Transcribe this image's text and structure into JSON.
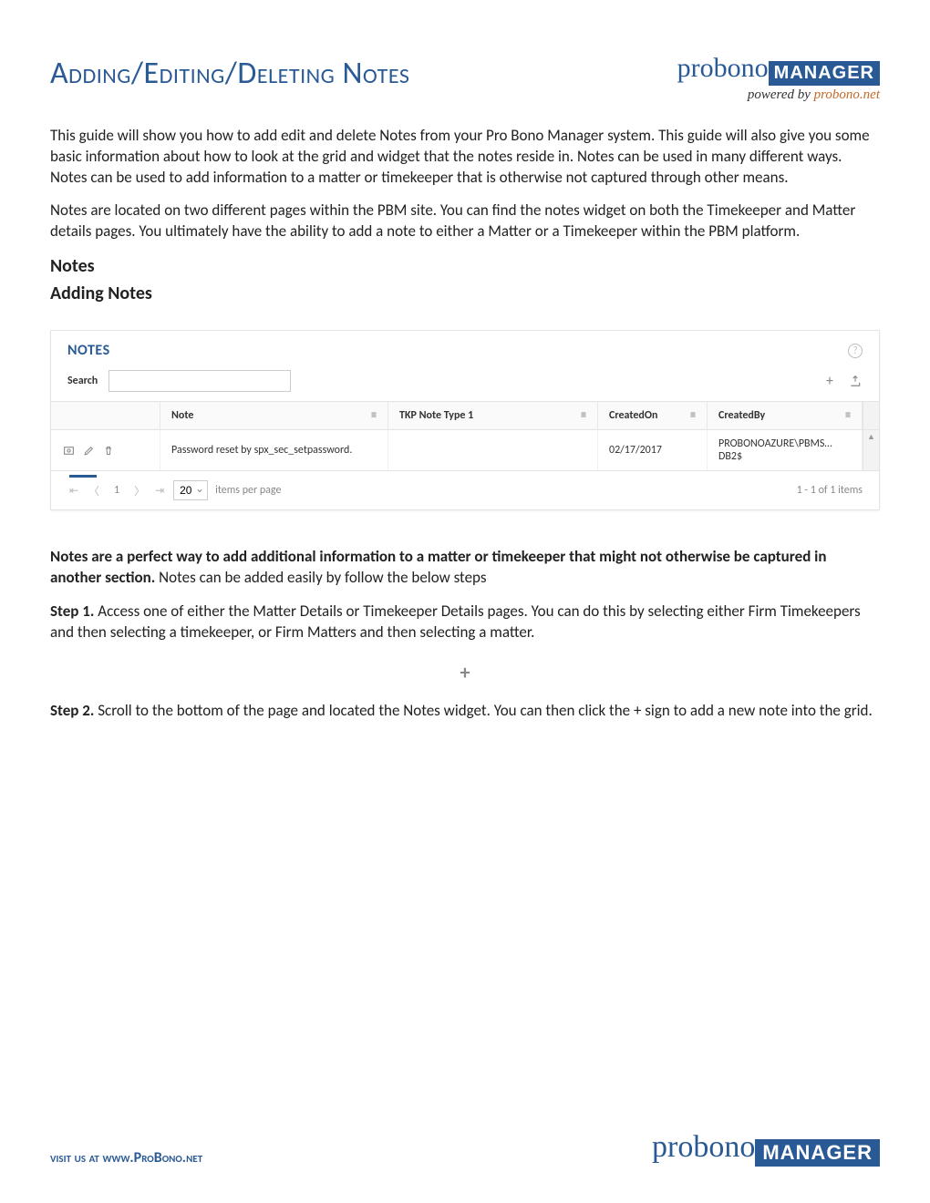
{
  "header": {
    "title": "Adding/Editing/Deleting Notes",
    "logo_word": "probono",
    "logo_badge": "MANAGER",
    "logo_sub_prefix": "powered by ",
    "logo_sub_link": "probono.net"
  },
  "intro": {
    "p1": "This guide will show you how to add edit and delete Notes from your Pro Bono Manager system. This guide will also give you some basic information about how to look at the grid and widget that the notes reside in. Notes can be used in many different ways. Notes can be used to add information to a matter or timekeeper that is otherwise not captured through other means.",
    "p2": "Notes are located on two different pages within the PBM site. You can find the notes widget on both the Timekeeper and Matter details pages. You ultimately have the ability to add a note to either a Matter or a Timekeeper within the PBM platform."
  },
  "sections": {
    "h_notes": "Notes",
    "h_adding": "Adding Notes"
  },
  "widget": {
    "title": "NOTES",
    "search_label": "Search",
    "search_value": "",
    "columns": {
      "note": "Note",
      "type": "TKP Note Type 1",
      "created_on": "CreatedOn",
      "created_by": "CreatedBy"
    },
    "rows": [
      {
        "note": "Password reset by spx_sec_setpassword.",
        "type": "",
        "created_on": "02/17/2017",
        "created_by": "PROBONOAZURE\\PBMS…DB2$"
      }
    ],
    "pager": {
      "current_page": "1",
      "page_size": "20",
      "items_label": "items per page",
      "summary": "1 - 1 of 1 items"
    }
  },
  "after": {
    "bold": "Notes are a perfect way to add additional information to a matter or timekeeper that might not otherwise be captured in another section.",
    "bold_tail": " Notes can be added easily by follow the below steps",
    "step1_label": "Step 1.",
    "step1_text": " Access one of either the Matter Details or Timekeeper Details pages. You can do this by selecting either Firm Timekeepers and then selecting a timekeeper, or Firm Matters and then selecting a matter.",
    "plus_glyph": "+",
    "step2_label": "Step 2.",
    "step2_text": " Scroll to the bottom of the page and located the Notes widget. You can then click the + sign to add a new note into the grid."
  },
  "footer": {
    "visit_prefix": "visit us at ",
    "visit_link": "www.ProBono.net"
  }
}
